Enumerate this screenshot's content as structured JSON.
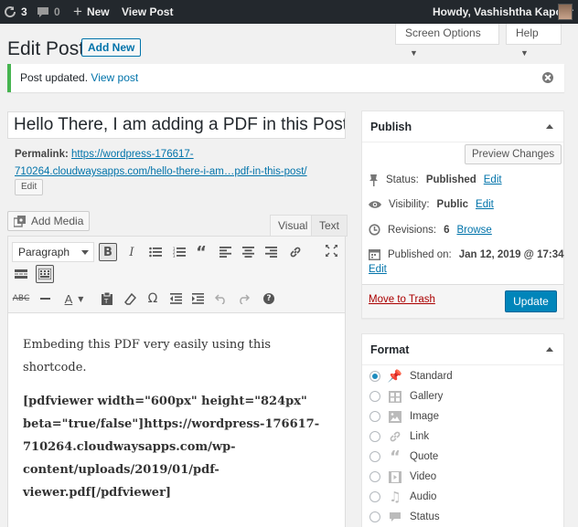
{
  "adminbar": {
    "updates_count": "3",
    "comments_count": "0",
    "new_label": "New",
    "view_post_label": "View Post",
    "howdy": "Howdy, Vashishtha Kapoor"
  },
  "header": {
    "title": "Edit Post",
    "add_new_label": "Add New",
    "screen_options_label": "Screen Options",
    "help_label": "Help"
  },
  "notice": {
    "text": "Post updated.",
    "link": "View post"
  },
  "post": {
    "title": "Hello There, I am adding a PDF in this Post",
    "permalink_label": "Permalink:",
    "permalink_line1": "https://wordpress-176617-",
    "permalink_line2": "710264.cloudwaysapps.com/hello-there-i-am…pdf-in-this-post/",
    "edit_permalink_label": "Edit"
  },
  "editor": {
    "add_media_label": "Add Media",
    "tab_visual": "Visual",
    "tab_text": "Text",
    "format_select": "Paragraph",
    "content_p1": "Embeding this PDF very easily using this shortcode.",
    "content_p2": "[pdfviewer width=\"600px\" height=\"824px\" beta=\"true/false\"]https://wordpress-176617-710264.cloudwaysapps.com/wp-content/uploads/2019/01/pdf-viewer.pdf[/pdfviewer]"
  },
  "publish": {
    "heading": "Publish",
    "preview_label": "Preview Changes",
    "status_label": "Status:",
    "status_value": "Published",
    "visibility_label": "Visibility:",
    "visibility_value": "Public",
    "revisions_label": "Revisions:",
    "revisions_value": "6",
    "browse_label": "Browse",
    "published_on_label": "Published on:",
    "published_on_value": "Jan 12, 2019 @ 17:34",
    "edit_label": "Edit",
    "trash_label": "Move to Trash",
    "update_label": "Update"
  },
  "format_box": {
    "heading": "Format",
    "options": [
      "Standard",
      "Gallery",
      "Image",
      "Link",
      "Quote",
      "Video",
      "Audio",
      "Status"
    ],
    "selected": "Standard"
  },
  "colors": {
    "adminbar_bg": "#23282d",
    "link": "#0073aa",
    "primary_button": "#0085ba",
    "notice_success": "#46b450",
    "trash": "#a00"
  }
}
